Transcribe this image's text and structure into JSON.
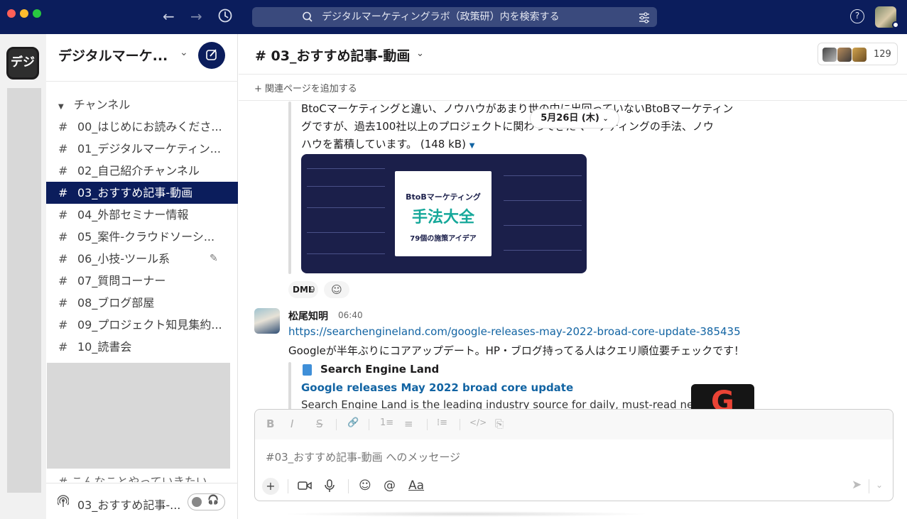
{
  "topbar": {
    "search_icon": "search-icon",
    "search_text": "デジタルマーケティングラボ（政策研）内を検索する",
    "help_label": "?"
  },
  "rail": {
    "workspace_icon_text": "デジ"
  },
  "sidebar": {
    "workspace_name": "デジタルマーケ...",
    "section_title": "チャンネル",
    "channels": [
      "00_はじめにお読みくださ...",
      "01_デジタルマーケティン...",
      "02_自己紹介チャンネル",
      "03_おすすめ記事-動画",
      "04_外部セミナー情報",
      "05_案件-クラウドソーシ...",
      "06_小技-ツール系",
      "07_質問コーナー",
      "08_ブログ部屋",
      "09_プロジェクト知見集約...",
      "10_読書会"
    ],
    "hash": "#",
    "partial_channel": "# こんなことやっていきたい",
    "huddle_channel": "03_おすすめ記事-..."
  },
  "header": {
    "channel_title": "# 03_おすすめ記事-動画",
    "member_count": "129",
    "add_bookmark": "+ 関連ページを追加する"
  },
  "messages": {
    "quote_lines": [
      "BtoCマーケティングと違い、ノウハウがあまり世の中に出回っていないBtoBマーケティン",
      "グですが、過去100社以上のプロジェクトに関わってきたマーケティングの手法、ノウ",
      "ハウを蓄積しています。"
    ],
    "file_size": "(148 kB)",
    "date_divider": "5月26日 (木)",
    "ebook": {
      "line1": "BtoBマーケティング",
      "line2": "手法大全",
      "line3": "79個の施策アイデア"
    },
    "reaction_emoji": "DML",
    "reaction_count": "9",
    "post": {
      "author": "松尾知明",
      "time": "06:40",
      "link": "https://searchengineland.com/google-releases-may-2022-broad-core-update-385435",
      "text": "Googleが半年ぶりにコアアップデート。HP・ブログ持ってる人はクエリ順位要チェックです！",
      "unfurl_site": "Search Engine Land",
      "unfurl_title": "Google releases May 2022 broad core update",
      "unfurl_desc": "Search Engine Land is the leading industry source for daily, must-read news"
    }
  },
  "composer": {
    "placeholder": "#03_おすすめ記事-動画 へのメッセージ",
    "format_buttons": [
      "B",
      "I",
      "S",
      "🔗",
      "1≡",
      "≡",
      "⁞≡",
      "</>",
      "⎘"
    ],
    "aa_label": "Aa",
    "at_label": "@"
  },
  "colors": {
    "topbar": "#0b1d5c",
    "active_channel": "#0b1d5c",
    "link": "#1264a3",
    "ebook_accent": "#16a89a"
  }
}
